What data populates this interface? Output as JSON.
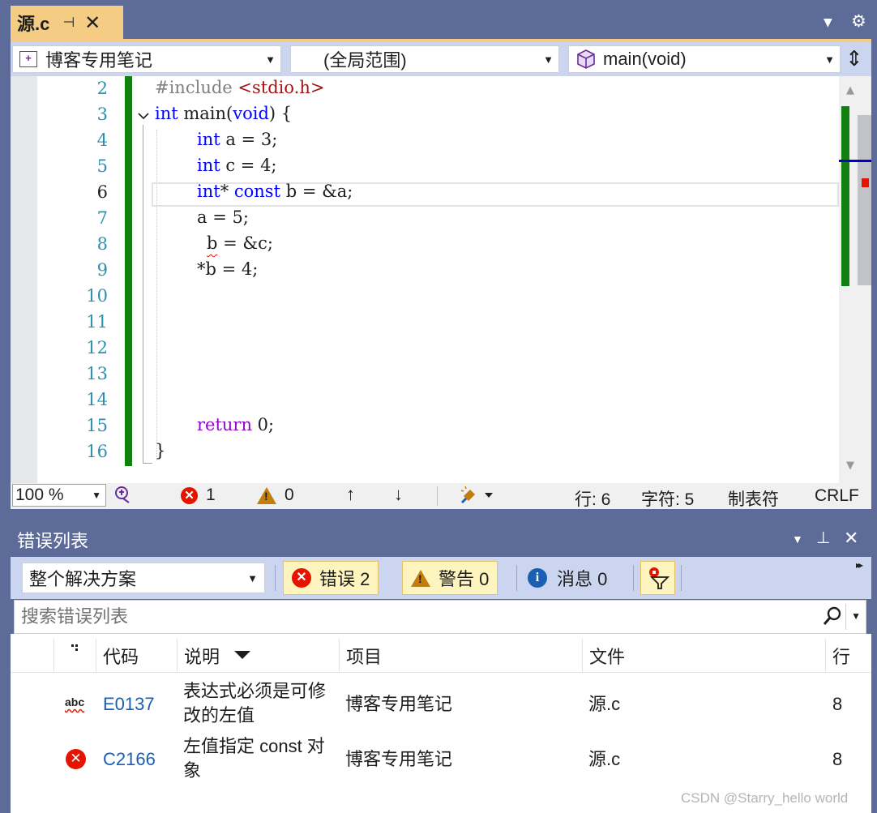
{
  "editor_tab": {
    "title": "源.c",
    "pin_glyph": "⊣",
    "close_glyph": "✕"
  },
  "tabstrip": {
    "dropdown_glyph": "▼",
    "gear_glyph": "⚙"
  },
  "navbar": {
    "project": "博客专用笔记",
    "scope": "(全局范围)",
    "member": "main(void)",
    "arrow_glyph": "▼",
    "split_glyph": "⇕"
  },
  "code": {
    "line_numbers": [
      "2",
      "3",
      "4",
      "5",
      "6",
      "7",
      "8",
      "9",
      "10",
      "11",
      "12",
      "13",
      "14",
      "15",
      "16"
    ],
    "current_line": "6",
    "include_directive": "#include",
    "include_header": "<stdio.h>",
    "main_type": "int",
    "main_name": "main(",
    "main_param": "void",
    "main_rest": ") {",
    "l4_type": "int",
    "l4_rest": " a = 3;",
    "l5_type": "int",
    "l5_rest": " c = 4;",
    "l6_type": "int",
    "l6_star": "* ",
    "l6_const": "const",
    "l6_rest": " b = &a;",
    "l7": "a = 5;",
    "l8_var": "b",
    "l8_rest": " = &c;",
    "l9_star": "*",
    "l9_var": "b",
    "l9_rest": " = 4;",
    "l15_kw": "return",
    "l15_rest": " 0;",
    "l16": "}"
  },
  "statusbar": {
    "zoom": "100 %",
    "errors": "1",
    "warnings": "0",
    "row": "行: 6",
    "column": "字符: 5",
    "indent": "制表符",
    "line_ending": "CRLF",
    "up_glyph": "↑",
    "down_glyph": "↓"
  },
  "error_list": {
    "title": "错误列表",
    "scope": "整个解决方案",
    "errors_label": "错误 2",
    "warnings_label": "警告 0",
    "messages_label": "消息 0",
    "search_placeholder": "搜索错误列表",
    "columns": [
      "代码",
      "说明",
      "项目",
      "文件",
      "行"
    ],
    "rows": [
      {
        "code": "E0137",
        "desc1": "表达式必须是可修",
        "desc2": "改的左值",
        "project": "博客专用笔记",
        "file": "源.c",
        "line": "8",
        "icon": "abc-squiggle-icon"
      },
      {
        "code": "C2166",
        "desc1": "左值指定 const 对",
        "desc2": "象",
        "project": "博客专用笔记",
        "file": "源.c",
        "line": "8",
        "icon": "error-circle-icon"
      }
    ]
  },
  "watermark": "CSDN @Starry_hello world",
  "colors": {
    "accent_tab": "#f5cc84",
    "chrome": "#5d6b99",
    "error": "#e51400",
    "warning": "#c27d0e",
    "info": "#1a5fb4",
    "change_bar": "#108010"
  }
}
